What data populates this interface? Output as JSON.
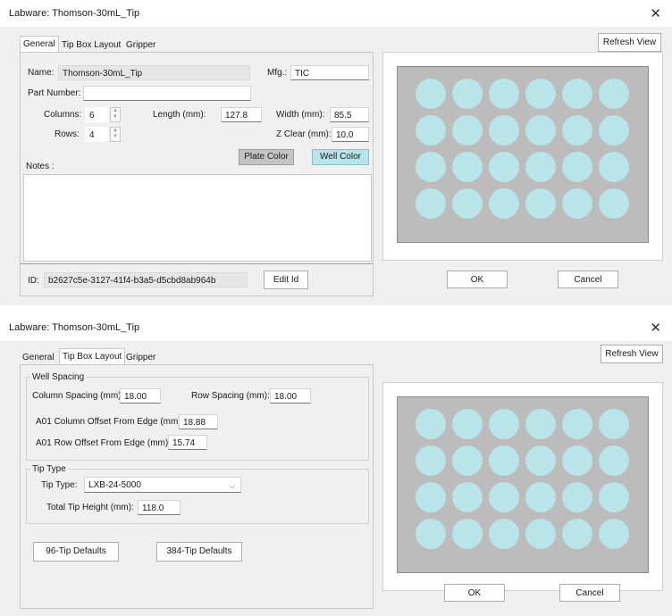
{
  "window1": {
    "title": "Labware: Thomson-30mL_Tip",
    "close": "✕",
    "tabs": [
      "General",
      "Tip Box Layout",
      "Gripper"
    ],
    "refresh_label": "Refresh View",
    "name_label": "Name:",
    "name_value": "Thomson-30mL_Tip",
    "mfg_label": "Mfg.:",
    "mfg_value": "TIC",
    "part_label": "Part Number:",
    "part_value": "",
    "columns_label": "Columns:",
    "columns_value": "6",
    "rows_label": "Rows:",
    "rows_value": "4",
    "length_label": "Length (mm):",
    "length_value": "127.8",
    "width_label": "Width (mm):",
    "width_value": "85.5",
    "zclear_label": "Z Clear (mm):",
    "zclear_value": "10.0",
    "plate_color_label": "Plate Color",
    "well_color_label": "Well Color",
    "notes_label": "Notes :",
    "notes_value": "",
    "id_label": "ID:",
    "id_value": "b2627c5e-3127-41f4-b3a5-d5cbd8ab964b",
    "edit_id_label": "Edit Id",
    "ok_label": "OK",
    "cancel_label": "Cancel"
  },
  "window2": {
    "title": "Labware: Thomson-30mL_Tip",
    "close": "✕",
    "tabs": [
      "General",
      "Tip Box Layout",
      "Gripper"
    ],
    "refresh_label": "Refresh View",
    "well_spacing_title": "Well Spacing",
    "col_spacing_label": "Column Spacing (mm):",
    "col_spacing_value": "18.00",
    "row_spacing_label": "Row Spacing (mm):",
    "row_spacing_value": "18.00",
    "a01_col_offset_label": "A01 Column Offset From Edge (mm):",
    "a01_col_offset_value": "18.88",
    "a01_row_offset_label": "A01 Row Offset From Edge (mm):",
    "a01_row_offset_value": "15.74",
    "tip_type_title": "Tip Type",
    "tip_type_label": "Tip Type:",
    "tip_type_value": "LXB-24-5000",
    "total_tip_height_label": "Total Tip Height (mm):",
    "total_tip_height_value": "118.0",
    "defaults_96_label": "96-Tip Defaults",
    "defaults_384_label": "384-Tip Defaults",
    "ok_label": "OK",
    "cancel_label": "Cancel"
  },
  "preview": {
    "columns": 6,
    "rows": 4,
    "plate_color": "#bcbcbc",
    "well_color": "#b8e4ea"
  }
}
